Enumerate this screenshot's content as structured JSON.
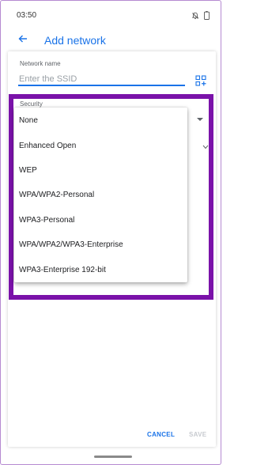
{
  "status_bar": {
    "time": "03:50",
    "icons": [
      "notifications-off-icon",
      "battery-icon"
    ]
  },
  "app_bar": {
    "back_icon": "arrow-back-icon",
    "title": "Add network"
  },
  "form": {
    "network_name_label": "Network name",
    "ssid_value": "",
    "ssid_placeholder": "Enter the SSID",
    "qr_icon": "qr-scan-icon",
    "security_label": "Security",
    "security_options": [
      "None",
      "Enhanced Open",
      "WEP",
      "WPA/WPA2-Personal",
      "WPA3-Personal",
      "WPA/WPA2/WPA3-Enterprise",
      "WPA3-Enterprise 192-bit"
    ]
  },
  "buttons": {
    "cancel": "CANCEL",
    "save": "SAVE"
  },
  "colors": {
    "accent": "#1a73e8",
    "highlight_border": "#7a12a9",
    "disabled_text": "#c7cacf"
  }
}
